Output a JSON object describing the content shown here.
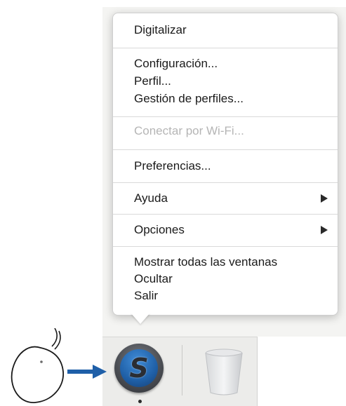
{
  "menu": {
    "items": [
      {
        "label": "Digitalizar",
        "enabled": true,
        "submenu": false
      },
      {
        "label": "Configuración...",
        "enabled": true,
        "submenu": false
      },
      {
        "label": "Perfil...",
        "enabled": true,
        "submenu": false
      },
      {
        "label": "Gestión de perfiles...",
        "enabled": true,
        "submenu": false
      },
      {
        "label": "Conectar por Wi-Fi...",
        "enabled": false,
        "submenu": false
      },
      {
        "label": "Preferencias...",
        "enabled": true,
        "submenu": false
      },
      {
        "label": "Ayuda",
        "enabled": true,
        "submenu": true
      },
      {
        "label": "Opciones",
        "enabled": true,
        "submenu": true
      },
      {
        "label": "Mostrar todas las ventanas",
        "enabled": true,
        "submenu": false
      },
      {
        "label": "Ocultar",
        "enabled": true,
        "submenu": false
      },
      {
        "label": "Salir",
        "enabled": true,
        "submenu": false
      }
    ]
  },
  "dock": {
    "app_icon": "scansnap-s-icon",
    "app_letter": "S",
    "trash_icon": "trash-icon",
    "running_indicator": true
  },
  "illustration": {
    "mouse_icon": "mouse-icon",
    "arrow_icon": "right-arrow-icon",
    "arrow_color": "#1f5fa8"
  }
}
